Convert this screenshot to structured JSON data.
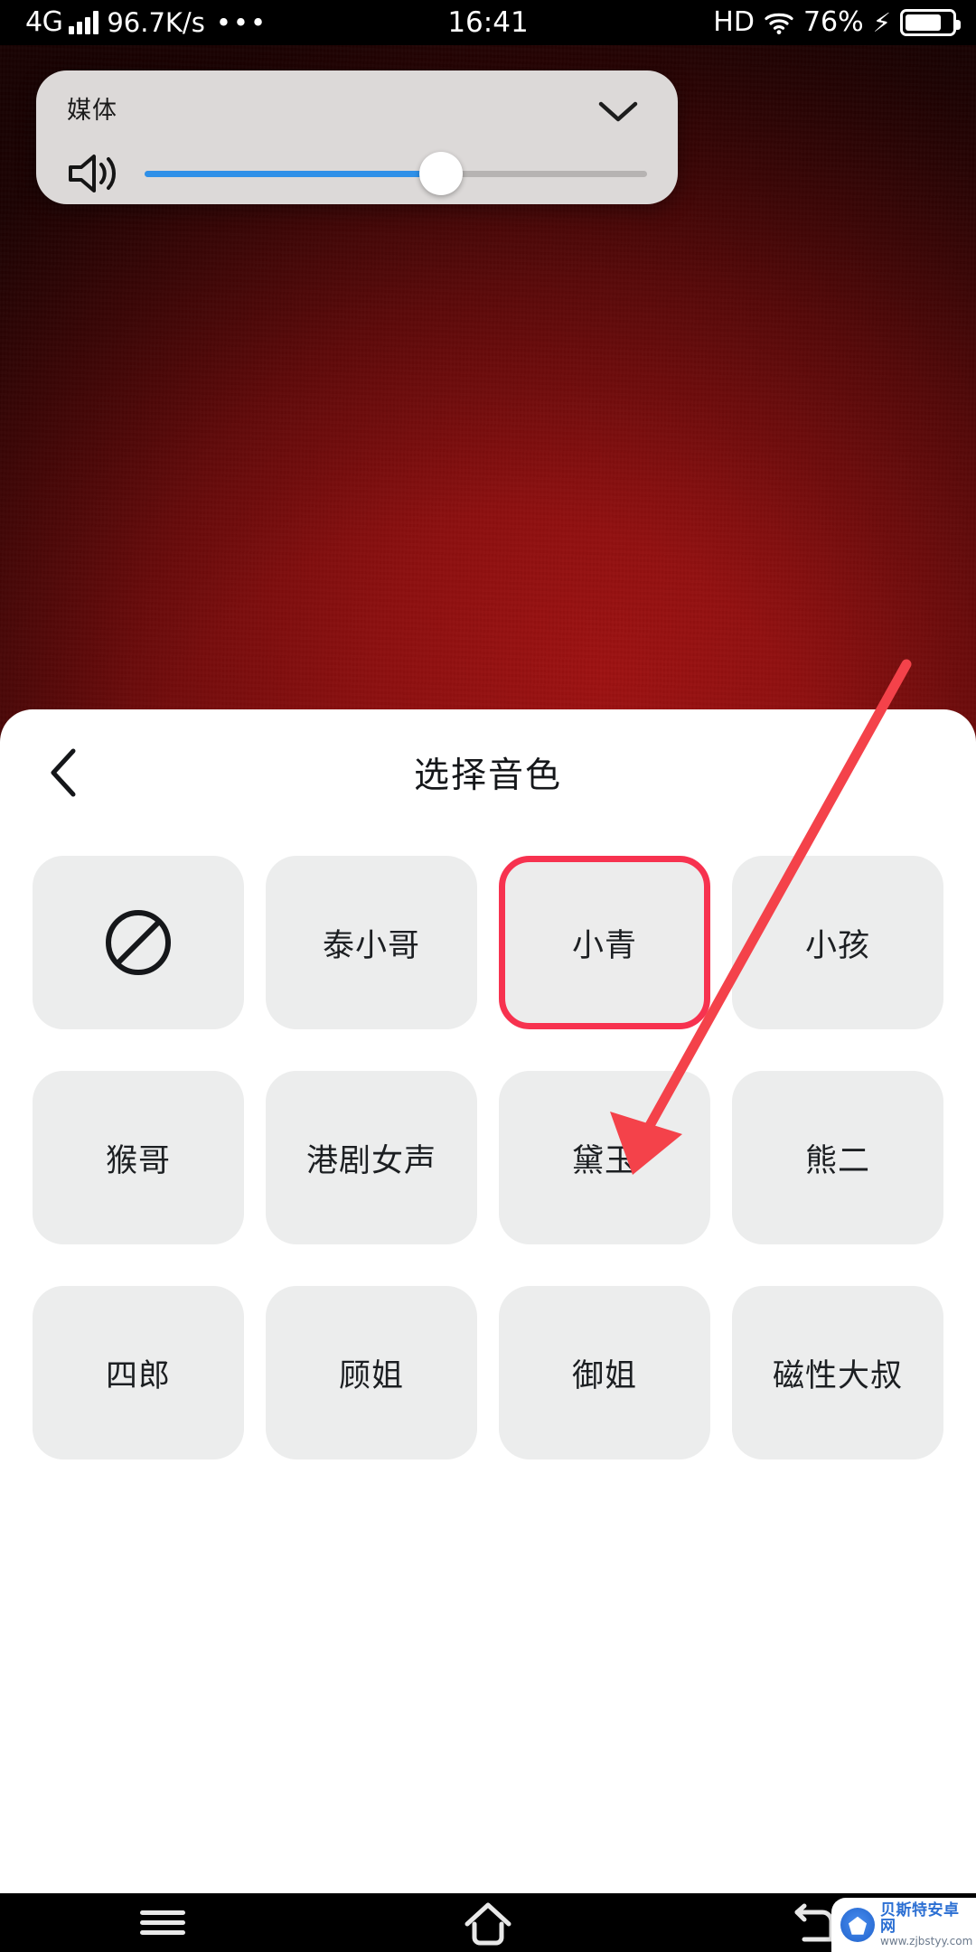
{
  "status_bar": {
    "network_type": "4G",
    "signal_icon": "signal-bars-icon",
    "data_speed": "96.7K/s",
    "more_icon": "ellipsis-icon",
    "time": "16:41",
    "hd_label": "HD",
    "wifi_icon": "wifi-icon",
    "battery_percent": "76%",
    "charging_icon": "lightning-bolt-icon",
    "battery_icon": "battery-icon"
  },
  "volume_panel": {
    "title": "媒体",
    "collapse_icon": "chevron-down-icon",
    "speaker_icon": "speaker-volume-icon",
    "slider_percent": 59,
    "track_color": "#2f90e8"
  },
  "sheet": {
    "back_icon": "chevron-left-icon",
    "title": "选择音色",
    "selected_tile": "小青",
    "selected_color": "#f7324f",
    "tiles": [
      {
        "label": "",
        "icon": "prohibition-icon",
        "selected": false
      },
      {
        "label": "泰小哥",
        "icon": "",
        "selected": false
      },
      {
        "label": "小青",
        "icon": "",
        "selected": true
      },
      {
        "label": "小孩",
        "icon": "",
        "selected": false
      },
      {
        "label": "猴哥",
        "icon": "",
        "selected": false
      },
      {
        "label": "港剧女声",
        "icon": "",
        "selected": false
      },
      {
        "label": "黛玉",
        "icon": "",
        "selected": false
      },
      {
        "label": "熊二",
        "icon": "",
        "selected": false
      },
      {
        "label": "四郎",
        "icon": "",
        "selected": false
      },
      {
        "label": "顾姐",
        "icon": "",
        "selected": false
      },
      {
        "label": "御姐",
        "icon": "",
        "selected": false
      },
      {
        "label": "磁性大叔",
        "icon": "",
        "selected": false
      }
    ]
  },
  "annotation": {
    "arrow_color": "#f4424a",
    "arrow_target": "小青"
  },
  "nav_bar": {
    "menu_icon": "menu-icon",
    "home_icon": "home-icon",
    "back_icon": "back-arrow-icon"
  },
  "watermark": {
    "name": "贝斯特安卓网",
    "url": "www.zjbstyy.com"
  }
}
